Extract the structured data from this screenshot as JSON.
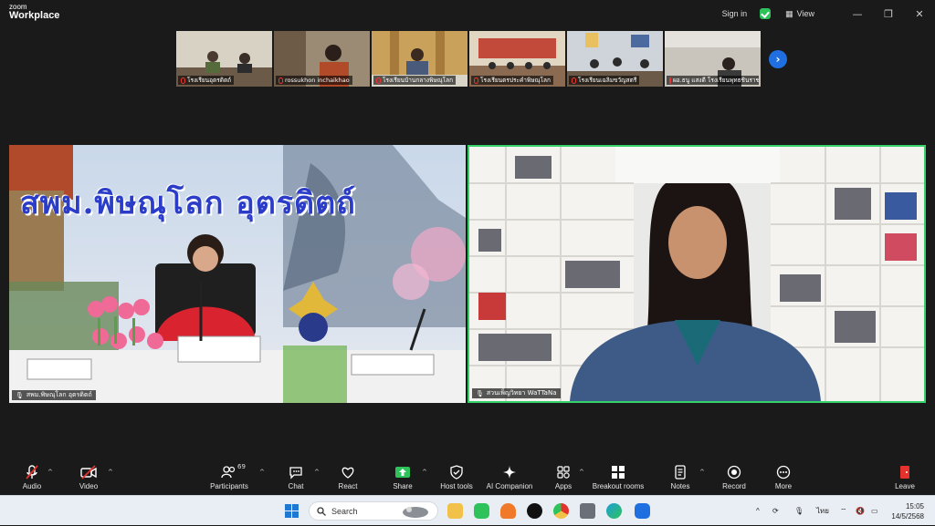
{
  "titlebar": {
    "logo_top": "zoom",
    "logo_bottom": "Workplace",
    "sign_in": "Sign in",
    "view": "View",
    "minimize": "—",
    "restore": "❐",
    "close": "✕"
  },
  "thumbnails": [
    {
      "name": "โรงเรียนอุตรดิตถ์",
      "bg": "#7a6a55"
    },
    {
      "name": "rossukhon inchaikhao",
      "bg": "#8a6f58"
    },
    {
      "name": "โรงเรียนบ้านกลางพิษณุโลก",
      "bg": "#c9a15a"
    },
    {
      "name": "โรงเรียนตรประคำพิษณุโลก",
      "bg": "#b8a27c"
    },
    {
      "name": "โรงเรียนเฉลิมขวัญสตรี",
      "bg": "#9aa1ad"
    },
    {
      "name": "ผอ.ธนู แสงดี โรงเรียนพุทธชินราช",
      "bg": "#b9b3ab"
    }
  ],
  "next_arrow": "›",
  "videos": {
    "left": {
      "label": "สพม.พิษณุโลก อุตรดิตถ์",
      "banner": "สพม.พิษณุโลก อุตรดิตถ์"
    },
    "right": {
      "label": "สวนเพ็ญวิทยา WaTTaNa"
    }
  },
  "toolbar": {
    "audio": "Audio",
    "video": "Video",
    "participants": "Participants",
    "participants_count": "69",
    "chat": "Chat",
    "react": "React",
    "share": "Share",
    "host_tools": "Host tools",
    "ai_companion": "AI Companion",
    "apps": "Apps",
    "breakout_rooms": "Breakout rooms",
    "notes": "Notes",
    "record": "Record",
    "more": "More",
    "leave": "Leave"
  },
  "taskbar": {
    "search_placeholder": "Search",
    "language": "ไทย",
    "time": "15:05",
    "date": "14/5/2568"
  },
  "colors": {
    "accent_green": "#35d26a",
    "share_green": "#2ec25a",
    "leave_red": "#e5322d",
    "blue": "#1f6fe0"
  }
}
